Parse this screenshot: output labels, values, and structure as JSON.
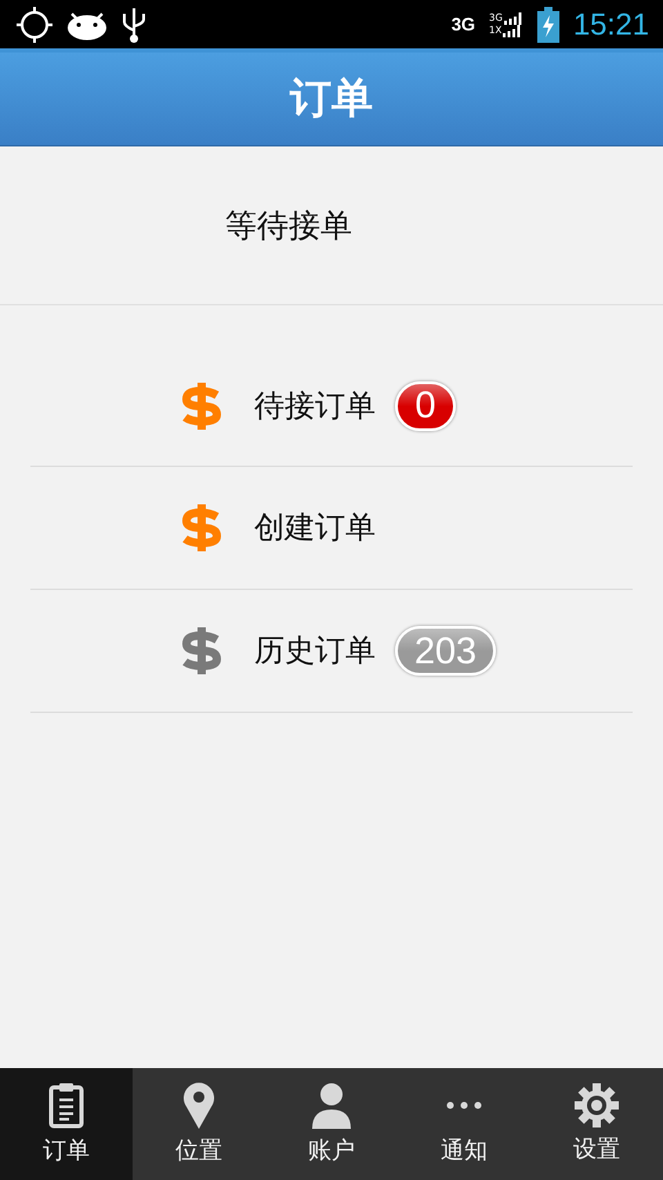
{
  "status_bar": {
    "network": "3G",
    "signal_labels": [
      "3G",
      "1X"
    ],
    "time": "15:21"
  },
  "header": {
    "title": "订单"
  },
  "status_text": "等待接单",
  "menu": [
    {
      "label": "待接订单",
      "color": "#ff7f00",
      "badge": {
        "text": "0",
        "color": "#d80000"
      }
    },
    {
      "label": "创建订单",
      "color": "#ff7f00"
    },
    {
      "label": "历史订单",
      "color": "#7a7a7a",
      "badge": {
        "text": "203",
        "color": "#9a9a9a"
      }
    }
  ],
  "tabs": [
    {
      "label": "订单",
      "selected": true
    },
    {
      "label": "位置",
      "selected": false
    },
    {
      "label": "账户",
      "selected": false
    },
    {
      "label": "通知",
      "selected": false
    },
    {
      "label": "设置",
      "selected": false
    }
  ]
}
